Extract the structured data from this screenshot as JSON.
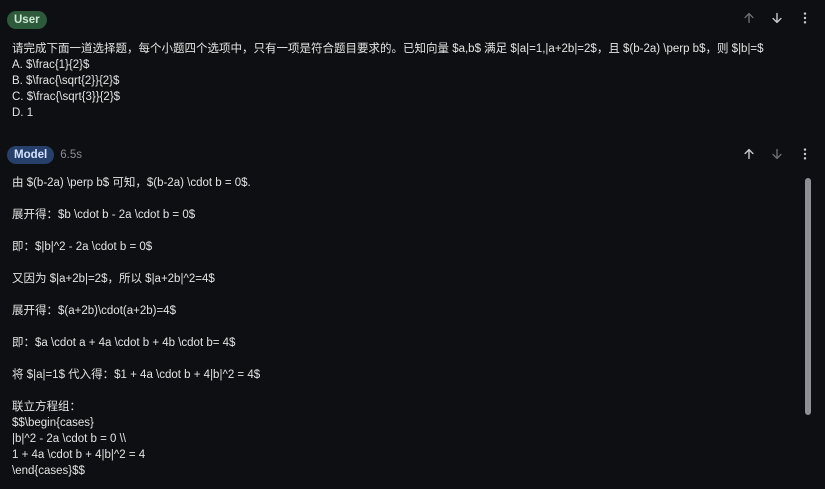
{
  "user_turn": {
    "role_label": "User",
    "actions": {
      "move_up": "arrow-up-icon",
      "move_down": "arrow-down-icon",
      "more": "more-vert-icon"
    },
    "lines": [
      "请完成下面一道选择题，每个小题四个选项中，只有一项是符合题目要求的。已知向量 $a,b$ 满足 $|a|=1,|a+2b|=2$，且 $(b-2a) \\perp b$，则 $|b|=$",
      "A. $\\frac{1}{2}$",
      "B. $\\frac{\\sqrt{2}}{2}$",
      "C. $\\frac{\\sqrt{3}}{2}$",
      "D. 1"
    ]
  },
  "model_turn": {
    "role_label": "Model",
    "elapsed": "6.5s",
    "actions": {
      "move_up": "arrow-up-icon",
      "move_down": "arrow-down-icon",
      "more": "more-vert-icon"
    },
    "lines": [
      "由 $(b-2a) \\perp b$ 可知，$(b-2a) \\cdot b = 0$.",
      "",
      "展开得：$b \\cdot b - 2a \\cdot b = 0$",
      "",
      "即：$|b|^2 - 2a \\cdot b = 0$",
      "",
      "又因为 $|a+2b|=2$，所以 $|a+2b|^2=4$",
      "",
      "展开得：$(a+2b)\\cdot(a+2b)=4$",
      "",
      "即：$a \\cdot a + 4a \\cdot b + 4b \\cdot b= 4$",
      "",
      "将 $|a|=1$ 代入得：$1 + 4a \\cdot b + 4|b|^2 = 4$",
      "",
      "联立方程组：",
      "$$\\begin{cases}",
      "|b|^2 - 2a \\cdot b = 0 \\\\",
      "1 + 4a \\cdot b + 4|b|^2 = 4",
      "\\end{cases}$$"
    ]
  }
}
